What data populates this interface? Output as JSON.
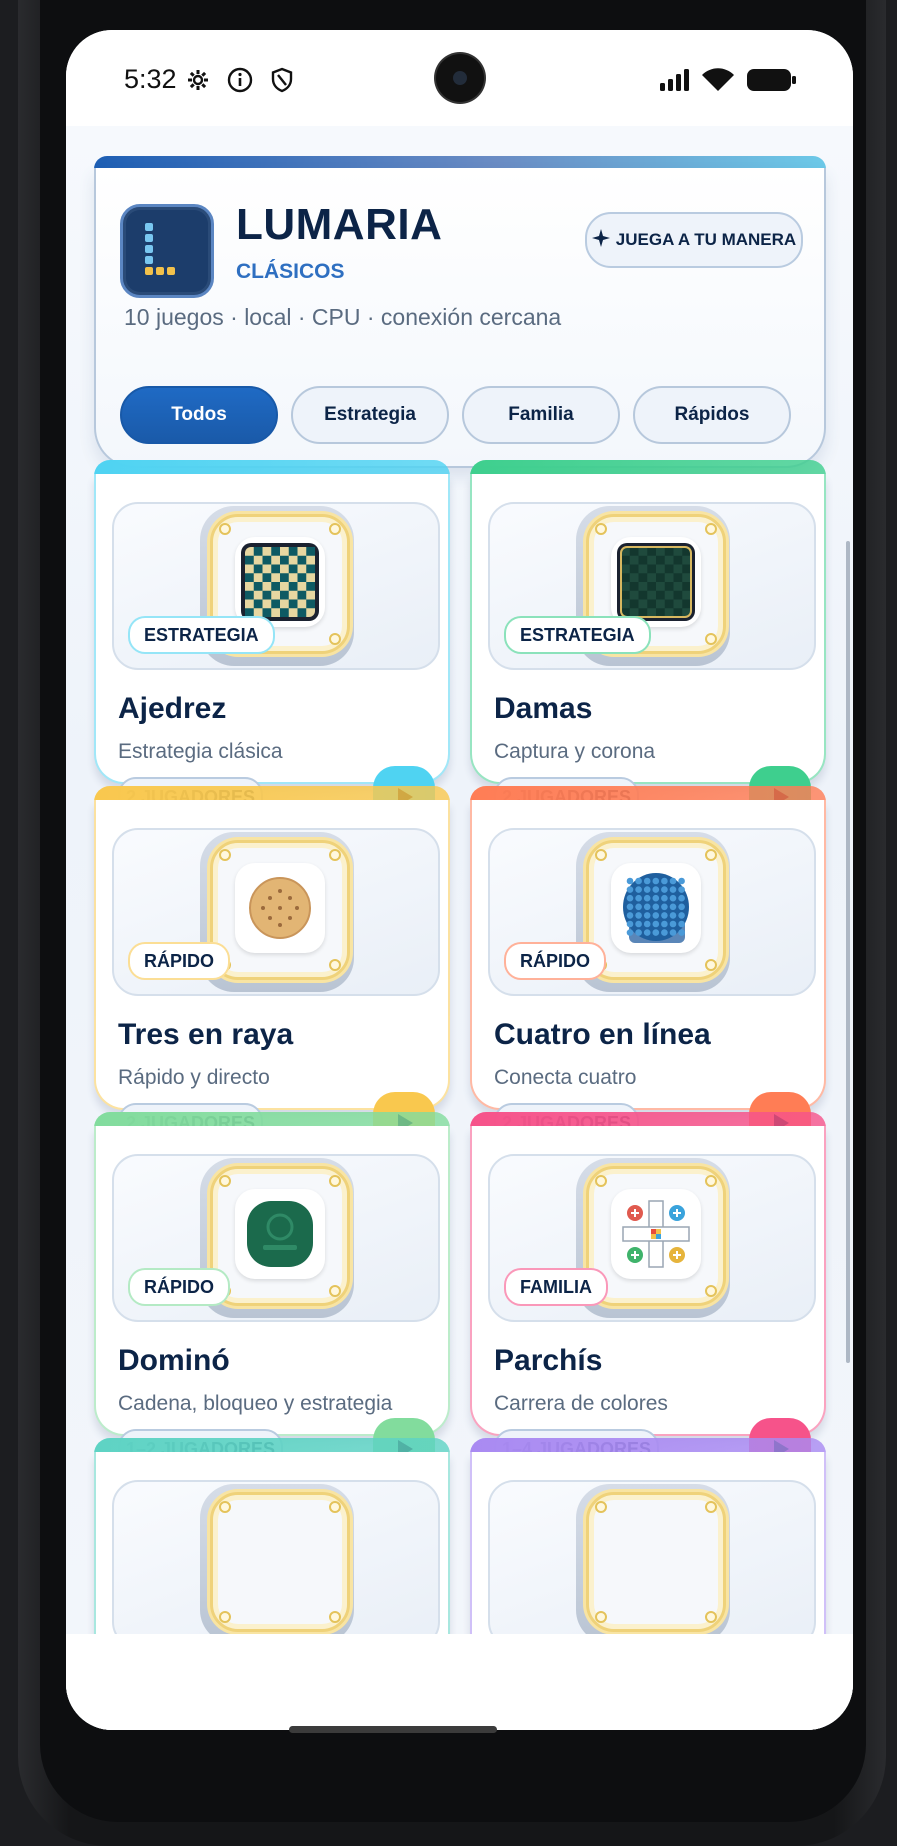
{
  "status_bar": {
    "time": "5:32",
    "icons": [
      "gear-icon",
      "info-icon",
      "shield-icon",
      "signal-icon",
      "wifi-icon",
      "battery-icon"
    ]
  },
  "header": {
    "brand": "LUMARIA",
    "subtitle": "CLÁSICOS",
    "play_button": "JUEGA A TU MANERA",
    "tagline": "10 juegos · local · CPU · conexión cercana"
  },
  "filters": [
    {
      "label": "Todos",
      "active": true
    },
    {
      "label": "Estrategia",
      "active": false
    },
    {
      "label": "Familia",
      "active": false
    },
    {
      "label": "Rápidos",
      "active": false
    }
  ],
  "games": [
    {
      "title": "Ajedrez",
      "desc": "Estrategia clásica",
      "category": "ESTRATEGIA",
      "players": "2 JUGADORES",
      "accent": "#4fd3f2",
      "icon": "chess-board-icon"
    },
    {
      "title": "Damas",
      "desc": "Captura y corona",
      "category": "ESTRATEGIA",
      "players": "2 JUGADORES",
      "accent": "#3ecf8e",
      "icon": "checkers-board-icon"
    },
    {
      "title": "Tres en raya",
      "desc": "Rápido y directo",
      "category": "RÁPIDO",
      "players": "2 JUGADORES",
      "accent": "#f9c84e",
      "icon": "tic-tac-toe-icon"
    },
    {
      "title": "Cuatro en línea",
      "desc": "Conecta cuatro",
      "category": "RÁPIDO",
      "players": "2 JUGADORES",
      "accent": "#ff7d55",
      "icon": "connect-four-icon"
    },
    {
      "title": "Dominó",
      "desc": "Cadena, bloqueo y estrategia",
      "category": "RÁPIDO",
      "players": "1–2 JUGADORES",
      "accent": "#82dc9d",
      "icon": "domino-icon"
    },
    {
      "title": "Parchís",
      "desc": "Carrera de colores",
      "category": "FAMILIA",
      "players": "1–4 JUGADORES",
      "accent": "#f6538a",
      "icon": "parchis-board-icon"
    },
    {
      "title": "",
      "desc": "",
      "category": "",
      "players": "",
      "accent": "#5ed3c4",
      "icon": ""
    },
    {
      "title": "",
      "desc": "",
      "category": "",
      "players": "",
      "accent": "#a98af2",
      "icon": ""
    }
  ]
}
